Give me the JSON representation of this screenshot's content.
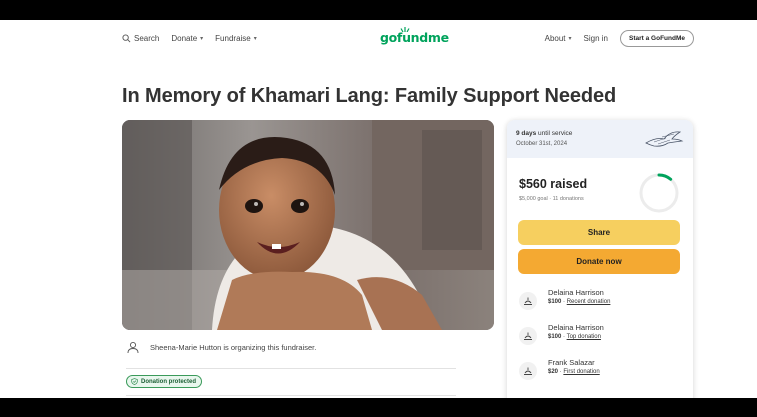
{
  "nav": {
    "search": "Search",
    "donate": "Donate",
    "fundraise": "Fundraise",
    "logo": "gofundme",
    "about": "About",
    "sign_in": "Sign in",
    "start": "Start a GoFundMe"
  },
  "campaign": {
    "title": "In Memory of Khamari Lang: Family Support Needed",
    "organizer_text": "Sheena-Marie Hutton is organizing this fundraiser.",
    "protected_label": "Donation protected"
  },
  "card": {
    "days_count": "9 days",
    "days_suffix": " until service",
    "service_date": "October 31st, 2024",
    "raised": "$560 raised",
    "goal": "$5,000 goal",
    "donations_count": "11 donations",
    "progress_fraction": 0.112,
    "share_label": "Share",
    "donate_label": "Donate now",
    "donations": [
      {
        "name": "Delaina Harrison",
        "amount": "$100",
        "tag": "Recent donation"
      },
      {
        "name": "Delaina Harrison",
        "amount": "$100",
        "tag": "Top donation"
      },
      {
        "name": "Frank Salazar",
        "amount": "$20",
        "tag": "First donation"
      }
    ]
  },
  "colors": {
    "brand_green": "#00a35c",
    "share_yellow": "#f6cf5f",
    "donate_orange": "#f4a932"
  }
}
